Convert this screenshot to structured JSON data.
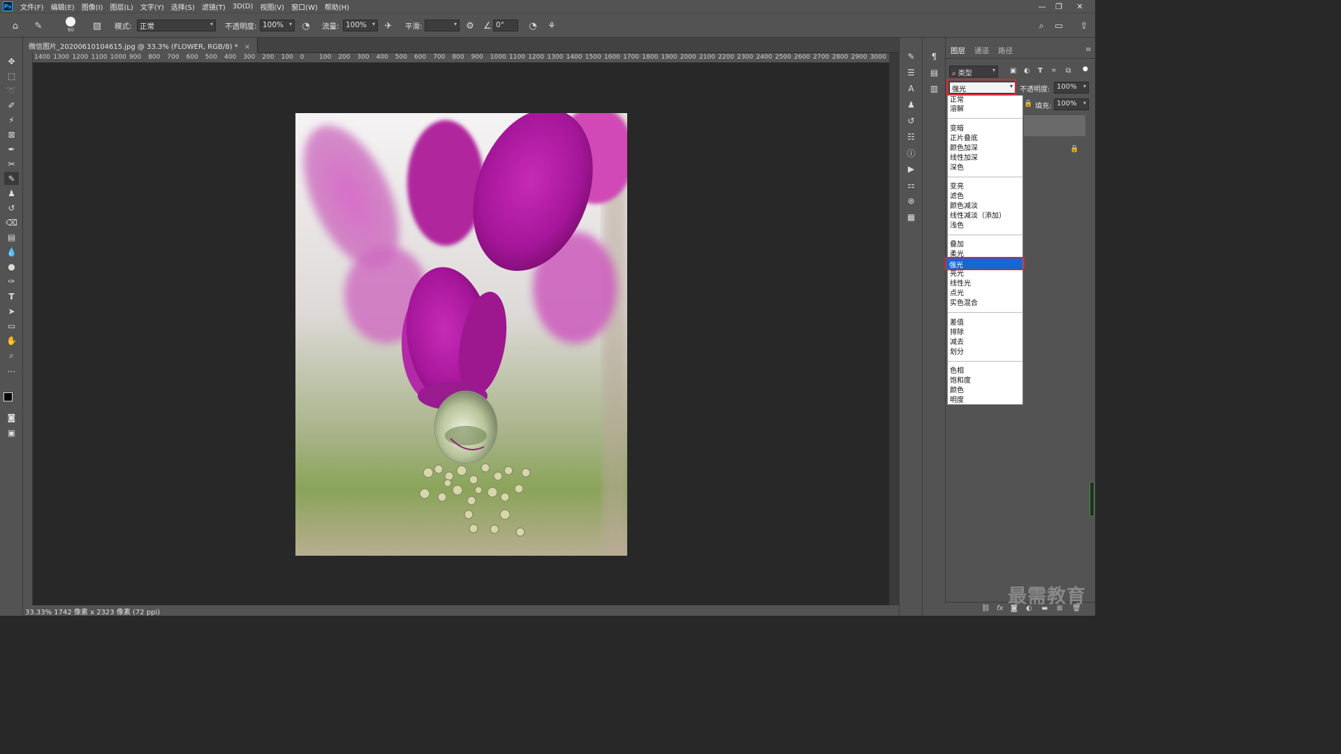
{
  "menubar": {
    "logo": "Ps",
    "items": [
      "文件(F)",
      "编辑(E)",
      "图像(I)",
      "图层(L)",
      "文字(Y)",
      "选择(S)",
      "滤镜(T)",
      "3D(D)",
      "视图(V)",
      "窗口(W)",
      "帮助(H)"
    ],
    "minimize": "—",
    "restore": "❐",
    "close": "✕"
  },
  "options": {
    "brush_size": "60",
    "mode_label": "模式:",
    "mode_value": "正常",
    "opacity_label": "不透明度:",
    "opacity_value": "100%",
    "flow_label": "流量:",
    "flow_value": "100%",
    "smooth_label": "平滑:",
    "smooth_value": "",
    "angle_value": "0°"
  },
  "document": {
    "tab_title": "微信图片_20200610104615.jpg @ 33.3% (FLOWER, RGB/8) *",
    "tab_close": "×",
    "ruler_labels": [
      "1400",
      "1300",
      "1200",
      "1100",
      "1000",
      "900",
      "800",
      "700",
      "600",
      "500",
      "400",
      "300",
      "200",
      "100",
      "0",
      "100",
      "200",
      "300",
      "400",
      "500",
      "600",
      "700",
      "800",
      "900",
      "1000",
      "1100",
      "1200",
      "1300",
      "1400",
      "1500",
      "1600",
      "1700",
      "1800",
      "1900",
      "2000",
      "2100",
      "2200",
      "2300",
      "2400",
      "2500",
      "2600",
      "2700",
      "2800",
      "2900",
      "3000"
    ],
    "status": "33.33%   1742 像素 x 2323 像素 (72 ppi)"
  },
  "layers_panel": {
    "tabs": [
      "图层",
      "通道",
      "路径"
    ],
    "filter_label": "类型",
    "blend_mode_selected": "强光",
    "opacity_label": "不透明度:",
    "opacity_value": "100%",
    "fill_label": "填充:",
    "fill_value": "100%"
  },
  "blend_modes": {
    "group1": [
      "正常",
      "溶解"
    ],
    "group2": [
      "变暗",
      "正片叠底",
      "颜色加深",
      "线性加深",
      "深色"
    ],
    "group3": [
      "变亮",
      "滤色",
      "颜色减淡",
      "线性减淡（添加）",
      "浅色"
    ],
    "group4": [
      "叠加",
      "柔光",
      "强光",
      "亮光",
      "线性光",
      "点光",
      "实色混合"
    ],
    "group5": [
      "差值",
      "排除",
      "减去",
      "划分"
    ],
    "group6": [
      "色相",
      "饱和度",
      "颜色",
      "明度"
    ]
  },
  "watermark": "最需教育",
  "colors": {
    "ui_panel": "#535353",
    "canvas_bg": "#282828",
    "highlight": "#1168d6",
    "annotation_red": "#e3232e"
  }
}
